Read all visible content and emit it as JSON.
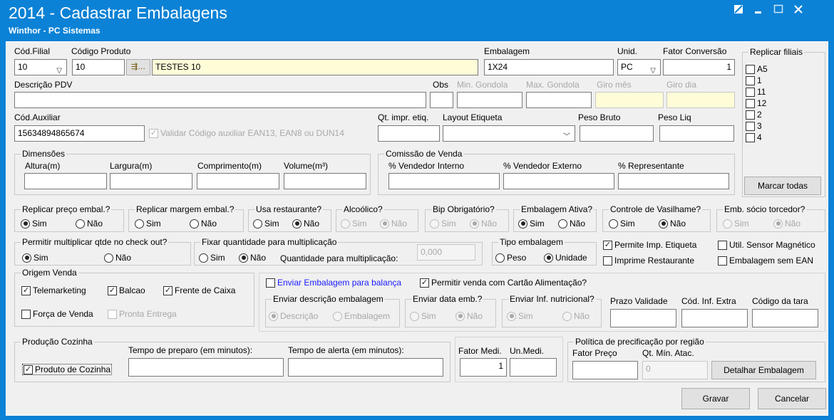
{
  "window": {
    "title": "2014 - Cadastrar Embalagens",
    "subtitle": "Winthor - PC Sistemas",
    "icons": {
      "restore": "restore-icon",
      "minimize": "minimize-icon",
      "maximize": "maximize-icon",
      "close": "close-icon"
    }
  },
  "fields": {
    "cod_filial": {
      "label": "Cód.Filial",
      "value": "10"
    },
    "codigo_produto": {
      "label": "Código Produto",
      "value": "10"
    },
    "produto_nome": {
      "value": "TESTES 10"
    },
    "embalagem": {
      "label": "Embalagem",
      "value": "1X24"
    },
    "unid": {
      "label": "Unid.",
      "value": "PC"
    },
    "fator_conversao": {
      "label": "Fator Conversão",
      "value": "1"
    },
    "descricao_pdv": {
      "label": "Descrição PDV",
      "value": ""
    },
    "obs": {
      "label": "Obs",
      "value": ""
    },
    "min_gondola": {
      "label": "Min. Gondola",
      "value": ""
    },
    "max_gondola": {
      "label": "Max. Gondola",
      "value": ""
    },
    "giro_mes": {
      "label": "Giro mês",
      "value": ""
    },
    "giro_dia": {
      "label": "Giro dia",
      "value": ""
    },
    "cod_auxiliar": {
      "label": "Cód.Auxiliar",
      "value": "15634894865674"
    },
    "validar_ean": {
      "label": "Validar Código auxiliar EAN13, EAN8 ou DUN14",
      "checked": true
    },
    "qt_impr_etiq": {
      "label": "Qt. impr. etiq.",
      "value": ""
    },
    "layout_etiqueta": {
      "label": "Layout Etiqueta",
      "value": ""
    },
    "peso_bruto": {
      "label": "Peso Bruto",
      "value": ""
    },
    "peso_liq": {
      "label": "Peso Liq",
      "value": ""
    }
  },
  "dimensoes": {
    "title": "Dimensões",
    "altura": "Altura(m)",
    "largura": "Largura(m)",
    "comprimento": "Comprimento(m)",
    "volume": "Volume(m³)"
  },
  "comissao": {
    "title": "Comissão de Venda",
    "interno": "% Vendedor Interno",
    "externo": "% Vendedor Externo",
    "representante": "% Representante"
  },
  "replicar_filiais": {
    "title": "Replicar filiais",
    "items": [
      "A5",
      "1",
      "11",
      "12",
      "2",
      "3",
      "4"
    ],
    "button": "Marcar todas"
  },
  "options": {
    "sim": "Sim",
    "nao": "Não"
  },
  "radio_groups": {
    "replicar_preco": {
      "title": "Replicar preço embal.?",
      "selected": "Sim"
    },
    "replicar_margem": {
      "title": "Replicar margem embal.?",
      "selected": ""
    },
    "usa_restaurante": {
      "title": "Usa restaurante?",
      "selected": "Não"
    },
    "alcoolico": {
      "title": "Alcoólico?",
      "selected": "Não"
    },
    "bip_obrigatorio": {
      "title": "Bip Obrigatório?",
      "selected": "Não"
    },
    "embalagem_ativa": {
      "title": "Embalagem Ativa?",
      "selected": "Sim"
    },
    "controle_vasilhame": {
      "title": "Controle de Vasilhame?",
      "selected": "Não"
    },
    "emb_socio": {
      "title": "Emb. sócio torcedor?",
      "selected": "Não"
    },
    "permitir_multiplicar": {
      "title": "Permitir multiplicar qtde no check out?",
      "selected": "Sim"
    },
    "fixar_quantidade": {
      "title": "Fixar quantidade para multiplicação",
      "selected": "Não",
      "qtd_label": "Quantidade para multiplicação:",
      "qtd_value": "0,000"
    },
    "tipo_embalagem": {
      "title": "Tipo embalagem",
      "peso": "Peso",
      "unidade": "Unidade",
      "selected": "Unidade"
    }
  },
  "checks": {
    "permite_imp_etiqueta": {
      "label": "Permite Imp. Etiqueta",
      "checked": true
    },
    "util_sensor": {
      "label": "Util. Sensor Magnético",
      "checked": false
    },
    "imprime_restaurante": {
      "label": "Imprime Restaurante",
      "checked": false
    },
    "embalagem_sem_ean": {
      "label": "Embalagem sem EAN",
      "checked": false
    }
  },
  "origem_venda": {
    "title": "Origem Venda",
    "telemarketing": "Telemarketing",
    "balcao": "Balcao",
    "frente_caixa": "Frente de Caixa",
    "forca_venda": "Força de Venda",
    "pronta_entrega": "Pronta Entrega"
  },
  "balanca": {
    "enviar_embalagem": "Enviar Embalagem para balança",
    "permitir_cartao": "Permitir venda com Cartão Alimentação?",
    "enviar_descricao": {
      "title": "Enviar descrição embalagem",
      "descricao": "Descrição",
      "embalagem": "Embalagem",
      "selected": "Descrição"
    },
    "enviar_data": {
      "title": "Enviar data emb.?",
      "selected": "Não"
    },
    "enviar_inf": {
      "title": "Enviar Inf. nutricional?",
      "selected": "Sim"
    },
    "prazo_validade": "Prazo Validade",
    "cod_inf_extra": "Cód. Inf. Extra",
    "codigo_tara": "Código da tara"
  },
  "producao": {
    "title": "Produção Cozinha",
    "produto_cozinha": "Produto de Cozinha",
    "tempo_preparo": "Tempo de preparo (em minutos):",
    "tempo_alerta": "Tempo de alerta (em minutos):"
  },
  "fator": {
    "label": "Fator Medi.",
    "un_label": "Un.Medi.",
    "value": "1",
    "un_value": ""
  },
  "politica": {
    "title": "Política de precificação por região",
    "fator_preco": "Fator Preço",
    "qt_min": "Qt. Mín. Atac.",
    "qt_min_value": "0",
    "detalhar": "Detalhar Embalagem"
  },
  "buttons": {
    "gravar": "Gravar",
    "cancelar": "Cancelar"
  }
}
